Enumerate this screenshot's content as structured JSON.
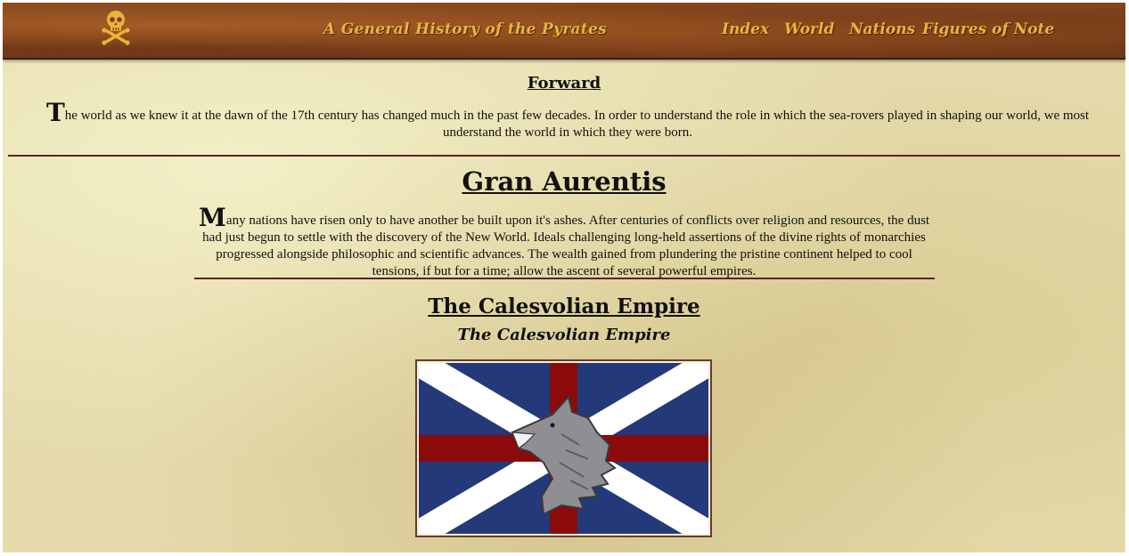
{
  "header": {
    "site_title": "A General History of the Pyrates",
    "nav": [
      "Index",
      "World",
      "Nations",
      "Figures of Note"
    ],
    "logo_icon": "skull-crossbones-icon",
    "accent_color": "#e9b43a"
  },
  "forward": {
    "heading": "Forward",
    "dropcap": "T",
    "text": "he world as we knew it at the dawn of the 17th century has changed much in the past few decades. In order to understand the role in which the sea-rovers played in shaping our world, we most understand the world in which they were born."
  },
  "gran_aurentis": {
    "heading": "Gran Aurentis",
    "dropcap": "M",
    "text": "any nations have risen only to have another be built upon it's ashes. After centuries of conflicts over religion and resources, the dust had just begun to settle with the discovery of the New World. Ideals challenging long-held assertions of the divine rights of monarchies progressed alongside philosophic and scientific advances. The wealth gained from plundering the pristine continent helped to cool tensions, if but for a time; allow the ascent of several powerful empires."
  },
  "nation": {
    "heading": "The Calesvolian Empire",
    "subheading": "The Calesvolian Empire",
    "flag_icon": "wolf-head-icon",
    "flag_colors": {
      "field": "#23397a",
      "saltire": "#ffffff",
      "cross": "#8b0a0a",
      "wolf": "#8e8e93"
    }
  }
}
